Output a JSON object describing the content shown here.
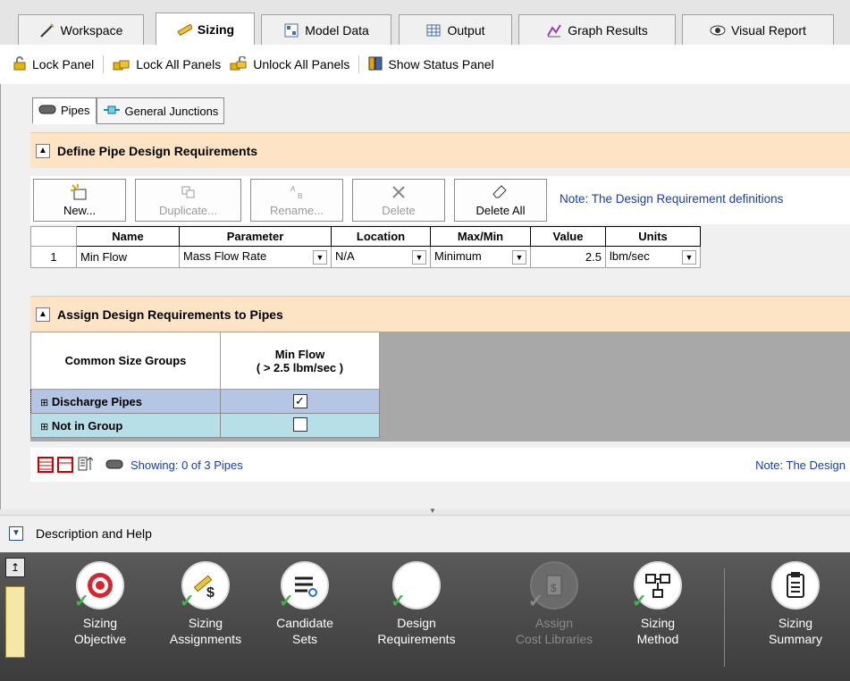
{
  "tabs": [
    {
      "label": "Workspace",
      "icon": "workspace-icon"
    },
    {
      "label": "Sizing",
      "icon": "ruler-pencil-icon",
      "active": true
    },
    {
      "label": "Model Data",
      "icon": "model-data-icon"
    },
    {
      "label": "Output",
      "icon": "table-icon"
    },
    {
      "label": "Graph Results",
      "icon": "graph-icon"
    },
    {
      "label": "Visual Report",
      "icon": "eye-icon"
    }
  ],
  "toolbar": {
    "lock_panel": "Lock Panel",
    "lock_all": "Lock All Panels",
    "unlock_all": "Unlock All Panels",
    "show_status": "Show Status Panel"
  },
  "subtabs": {
    "pipes": "Pipes",
    "junctions": "General Junctions"
  },
  "define_section": {
    "title": "Define Pipe Design Requirements",
    "buttons": {
      "new": "New...",
      "duplicate": "Duplicate...",
      "rename": "Rename...",
      "delete": "Delete",
      "delete_all": "Delete All"
    },
    "note": "Note: The Design Requirement definitions",
    "columns": [
      "Name",
      "Parameter",
      "Location",
      "Max/Min",
      "Value",
      "Units"
    ],
    "rows": [
      {
        "num": "1",
        "name": "Min Flow",
        "parameter": "Mass Flow Rate",
        "location": "N/A",
        "maxmin": "Minimum",
        "value": "2.5",
        "units": "lbm/sec"
      }
    ]
  },
  "assign_section": {
    "title": "Assign Design Requirements to Pipes",
    "col_groups": "Common Size Groups",
    "col_req_line1": "Min Flow",
    "col_req_line2": "( > 2.5 lbm/sec )",
    "rows": [
      {
        "label": "Discharge Pipes",
        "checked": true
      },
      {
        "label": "Not in Group",
        "checked": false
      }
    ],
    "showing": "Showing: 0 of 3 Pipes",
    "note": "Note: The Design"
  },
  "description": "Description and Help",
  "ribbon": [
    {
      "line1": "Sizing",
      "line2": "Objective",
      "icon": "target-icon",
      "done": true
    },
    {
      "line1": "Sizing",
      "line2": "Assignments",
      "icon": "ruler-dollar-icon",
      "done": true
    },
    {
      "line1": "Candidate",
      "line2": "Sets",
      "icon": "candidate-sets-icon",
      "done": true
    },
    {
      "line1": "Design",
      "line2": "Requirements",
      "icon": "fx-icon",
      "done": true
    },
    {
      "line1": "Assign",
      "line2": "Cost Libraries",
      "icon": "cost-library-icon",
      "done": false,
      "disabled": true
    },
    {
      "line1": "Sizing",
      "line2": "Method",
      "icon": "flowchart-icon",
      "done": true
    },
    {
      "line1": "Sizing",
      "line2": "Summary",
      "icon": "clipboard-icon",
      "done": false
    }
  ],
  "colors": {
    "section_header": "#fde4c4",
    "discharge_row": "#b4c6e4",
    "notgroup_row": "#b7dfe8",
    "link_blue": "#1a3ea8",
    "check_green": "#3cb84a"
  }
}
